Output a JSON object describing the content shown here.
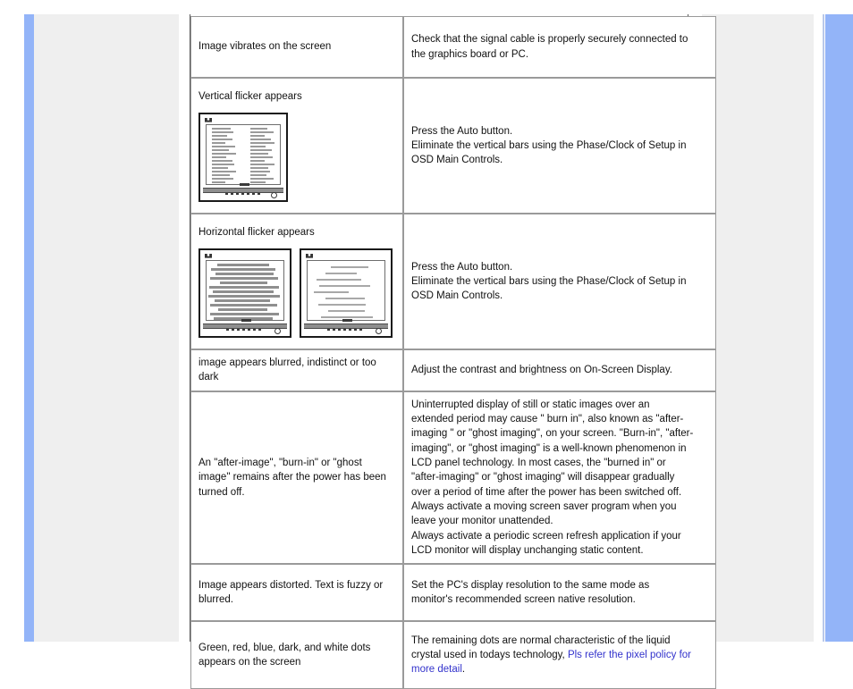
{
  "page": {
    "accent_color": "#93b4f8",
    "panel_color": "#efefef",
    "link_color": "#3333cc"
  },
  "table": {
    "rows": [
      {
        "id": "image-vibrates",
        "symptom": "Image vibrates on the screen",
        "solution_lines": [
          "Check that the signal cable is properly securely connected to",
          "the graphics board or PC."
        ],
        "thumbnails": []
      },
      {
        "id": "vertical-flicker",
        "symptom": "Vertical flicker appears",
        "solution_lines": [
          "Press the Auto button.",
          "Eliminate the vertical bars using the Phase/Clock of Setup in",
          "OSD Main Controls."
        ],
        "thumbnails": [
          "monitor-vertical-bars"
        ]
      },
      {
        "id": "horizontal-flicker",
        "symptom": "Horizontal flicker appears",
        "solution_lines": [
          "Press the Auto button.",
          "Eliminate the vertical bars using the Phase/Clock of Setup in",
          "OSD Main Controls."
        ],
        "thumbnails": [
          "monitor-horizontal-distorted",
          "monitor-horizontal-clean"
        ]
      },
      {
        "id": "image-blurred",
        "symptom": "image appears blurred, indistinct or too dark",
        "solution_lines": [
          "Adjust the contrast and brightness on On-Screen Display."
        ],
        "thumbnails": []
      },
      {
        "id": "after-image-burn-in",
        "symptom": "An \"after-image\", \"burn-in\" or \"ghost image\" remains after the power has been turned off.",
        "solution_lines": [
          "Uninterrupted display of still or static images over an",
          "extended period may cause \" burn in\", also known as \"after-",
          "imaging \" or \"ghost imaging\", on your screen. \"Burn-in\", \"after-",
          "imaging\", or \"ghost imaging\" is a well-known phenomenon in",
          "LCD panel technology. In most cases, the \"burned in\" or",
          "\"after-imaging\" or \"ghost imaging\" will disappear gradually",
          "over a period of time after the power has been switched off.",
          "Always activate a moving screen saver program when you",
          "leave your monitor unattended.",
          "Always activate a periodic screen refresh application if your",
          "LCD monitor will display unchanging static content."
        ],
        "thumbnails": []
      },
      {
        "id": "image-distorted",
        "symptom": "Image appears distorted. Text   is fuzzy or blurred.",
        "solution_lines": [
          "Set the PC's display resolution to the same mode as",
          "monitor's recommended screen native resolution."
        ],
        "thumbnails": []
      },
      {
        "id": "colored-dots",
        "symptom": "Green, red, blue, dark, and white dots appears on the screen",
        "solution_lines": [
          "The remaining dots are normal characteristic of the liquid",
          "crystal used in todays technology, "
        ],
        "solution_link": "Pls refer the pixel policy for more detail",
        "solution_tail": ".",
        "thumbnails": []
      }
    ]
  }
}
